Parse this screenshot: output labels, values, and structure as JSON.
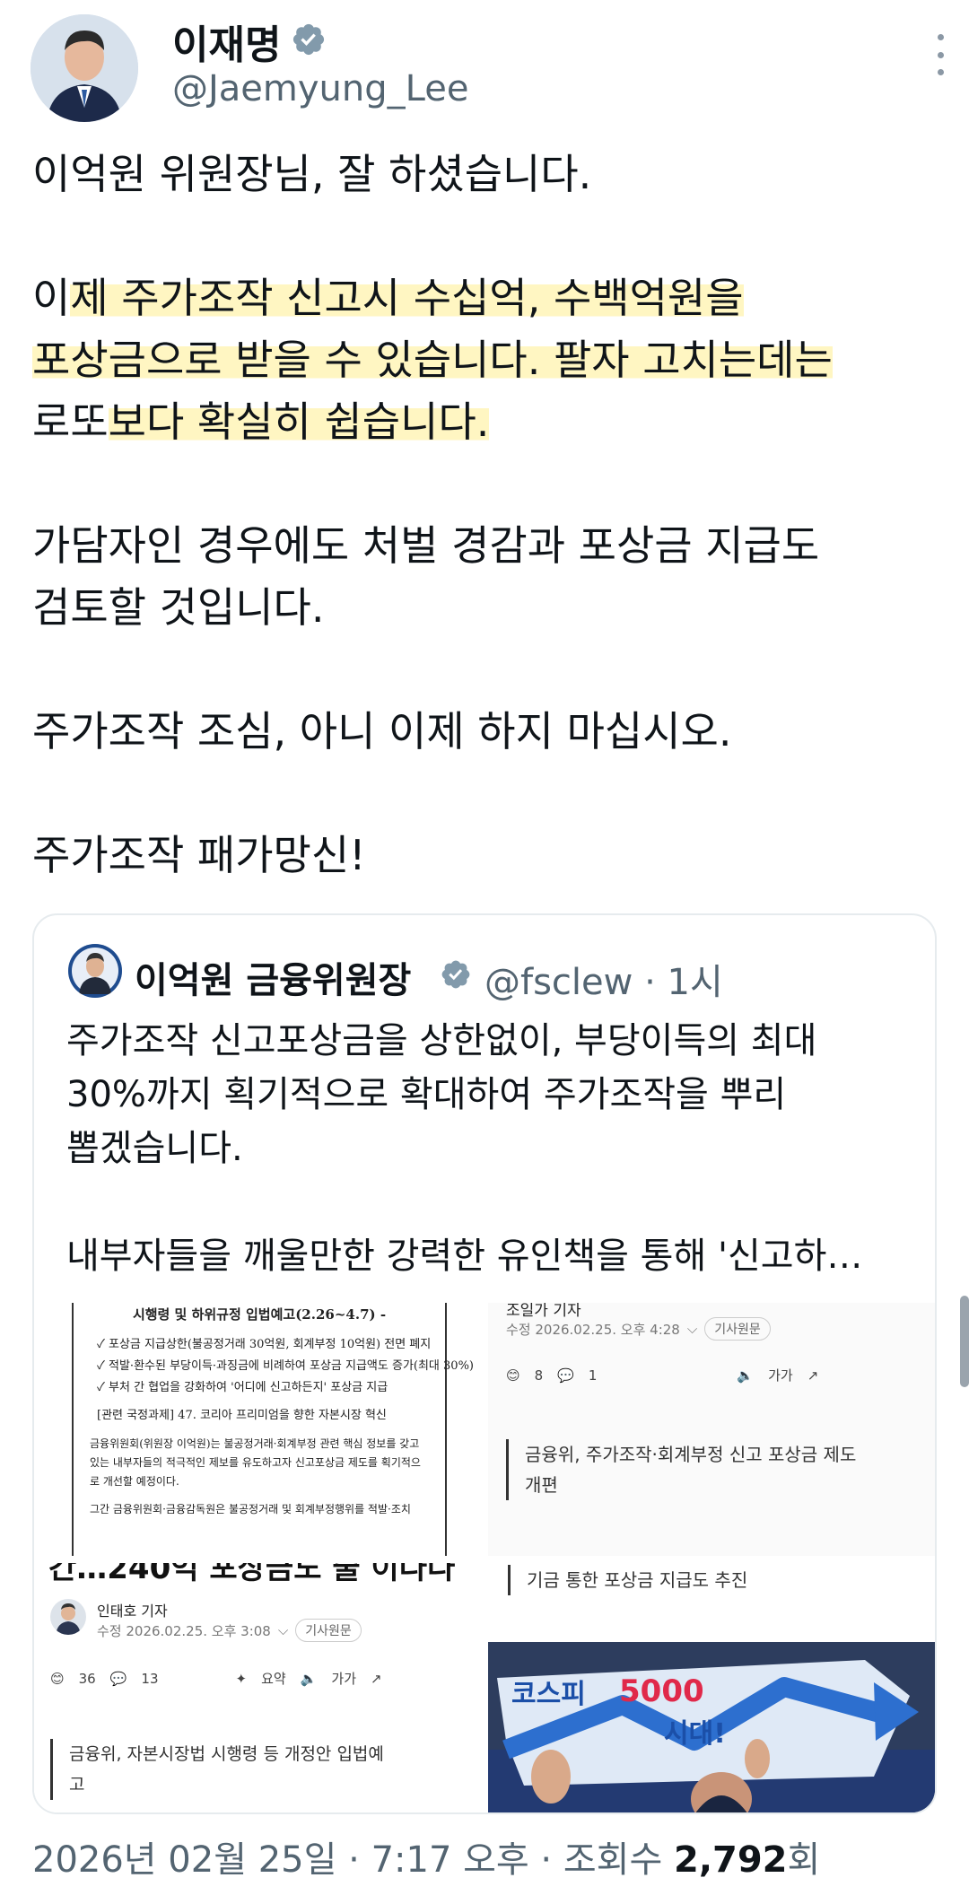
{
  "author": {
    "display_name": "이재명",
    "handle": "@Jaemyung_Lee",
    "avatar_icon": "profile-photo",
    "verified_color": "#829aab"
  },
  "tweet": {
    "lines": [
      "이억원 위원장님, 잘 하셨습니다.",
      "",
      "이제 주가조작 신고시 수십억, 수백억원을",
      "포상금으로 받을 수 있습니다. 팔자 고치는데는",
      "로또보다 확실히 쉽습니다.",
      "",
      "가담자인 경우에도 처벌 경감과 포상금 지급도",
      "검토할 것입니다.",
      "",
      "주가조작 조심, 아니 이제 하지 마십시오.",
      "",
      "주가조작 패가망신!"
    ],
    "highlight_color": "#fff6c2"
  },
  "quote": {
    "display_name": "이억원 금융위원장",
    "handle": "@fsclew",
    "time": "· 1시",
    "lines": [
      "주가조작 신고포상금을 상한없이, 부당이득의 최대",
      "30%까지 획기적으로 확대하여 주가조작을 뿌리",
      "뽑겠습니다.",
      "",
      "내부자들을 깨울만한 강력한 유인책을 통해 '신고하…"
    ],
    "media": {
      "doc": {
        "title": "시행령 및 하위규정 입법예고(2.26~4.7) -",
        "bullets": [
          "✓ 포상금 지급상한(불공정거래 30억원, 회계부정 10억원) 전면 폐지",
          "✓ 적발·환수된 부당이득·과징금에 비례하여 포상금 지급액도 증가(최대 30%)",
          "✓ 부처 간 협업을 강화하여 '어디에 신고하든지' 포상금 지급"
        ],
        "note": "[관련 국정과제] 47. 코리아 프리미엄을 향한 자본시장 혁신",
        "para": "금융위원회(위원장 이억원)는 불공정거래·회계부정 관련 핵심 정보를 갖고 있는 내부자들의 적극적인 제보를 유도하고자 신고포상금 제도를 획기적으로 개선할 예정이다.",
        "para2": "그간 금융위원회·금융감독원은 불공정거래 및 회계부정행위를 적발·조치"
      },
      "article_a": {
        "reporter_partial": "조일가 기자",
        "date": "수정 2026.02.25. 오후 4:28",
        "pill": "기사원문",
        "reactions": "8",
        "comments": "1",
        "font_label": "가가",
        "summary": [
          "금융위, 주가조작·회계부정 신고 포상금 제도",
          "개편"
        ]
      },
      "article_b": {
        "headline_partial": "간…240억 포상금도 줄 이다다",
        "reporter": "인태호 기자",
        "date": "수정 2026.02.25. 오후 3:08",
        "pill": "기사원문",
        "reactions": "36",
        "comments": "13",
        "summary_label": "요약",
        "font_label": "가가",
        "summary": [
          "금융위, 자본시장법 시행령 등 개정안 입법예",
          "고"
        ]
      },
      "article_c": {
        "summary": "기금 통한 포상금 지급도 추진",
        "sign_text_1": "코스피",
        "sign_text_2": "5000",
        "sign_text_3": "시대!"
      }
    }
  },
  "footer": {
    "timestamp": "2026년 02월 25일 · 7:17 오후 · 조회수",
    "views": "2,792",
    "views_suffix": "회"
  },
  "colors": {
    "text": "#0f1419",
    "secondary": "#536471",
    "border": "#e6ebee"
  }
}
